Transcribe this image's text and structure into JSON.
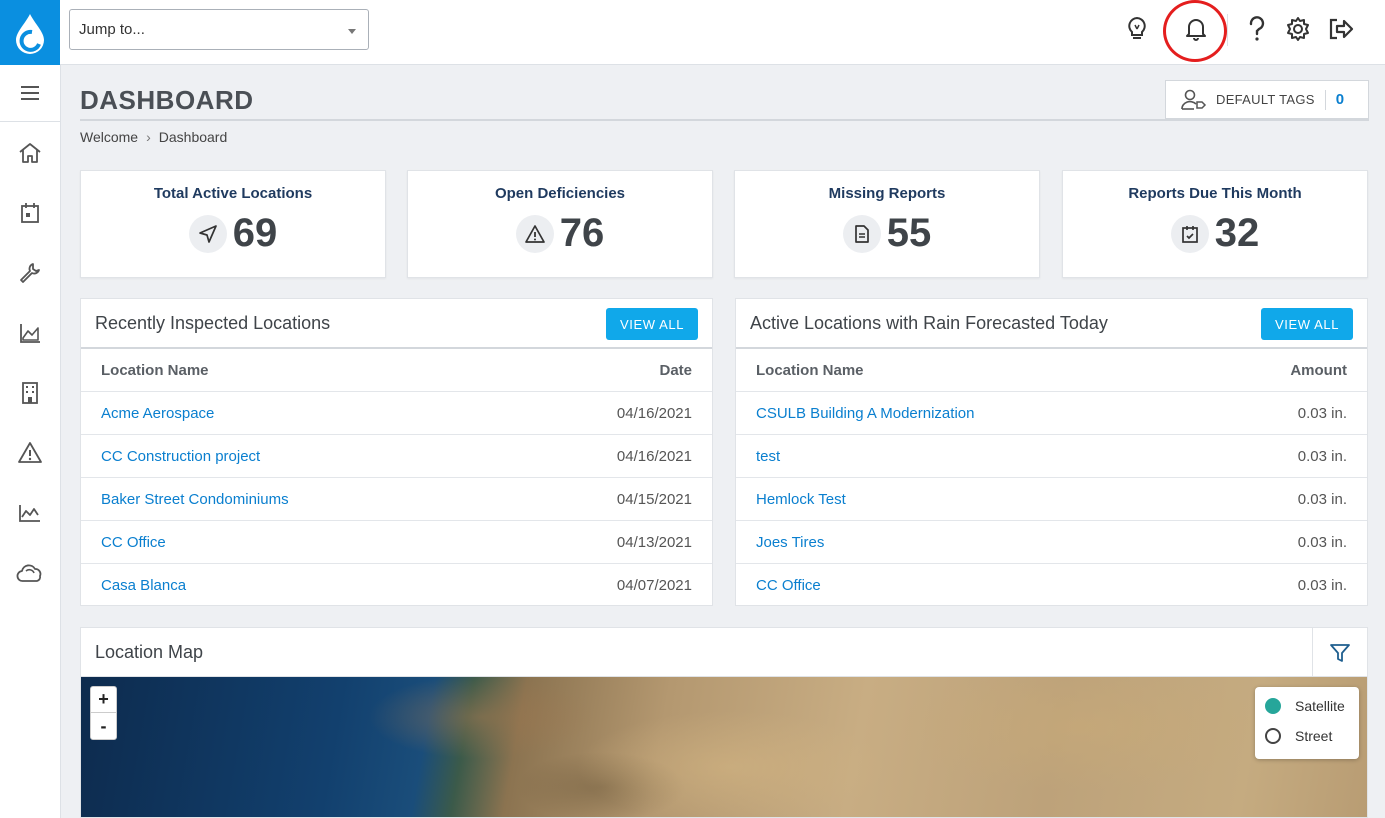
{
  "header": {
    "jump_placeholder": "Jump to...",
    "page_title": "DASHBOARD",
    "breadcrumb": [
      "Welcome",
      "Dashboard"
    ],
    "default_tags_label": "DEFAULT TAGS",
    "default_tags_count": "0"
  },
  "topbar_icons": [
    "lightbulb-icon",
    "bell-icon",
    "help-icon",
    "gear-icon",
    "logout-icon"
  ],
  "sidebar_icons": [
    "menu-icon",
    "home-icon",
    "calendar-icon",
    "wrench-icon",
    "chart-icon",
    "building-icon",
    "warning-icon",
    "area-chart-icon",
    "cloud-icon"
  ],
  "stats": [
    {
      "label": "Total Active Locations",
      "value": "69",
      "icon": "navigation-icon"
    },
    {
      "label": "Open Deficiencies",
      "value": "76",
      "icon": "warning-icon"
    },
    {
      "label": "Missing Reports",
      "value": "55",
      "icon": "document-icon"
    },
    {
      "label": "Reports Due This Month",
      "value": "32",
      "icon": "calendar-check-icon"
    }
  ],
  "recent": {
    "title": "Recently Inspected Locations",
    "view_all": "VIEW ALL",
    "col_name": "Location Name",
    "col_value": "Date",
    "rows": [
      {
        "name": "Acme Aerospace",
        "value": "04/16/2021"
      },
      {
        "name": "CC Construction project",
        "value": "04/16/2021"
      },
      {
        "name": "Baker Street Condominiums",
        "value": "04/15/2021"
      },
      {
        "name": "CC Office",
        "value": "04/13/2021"
      },
      {
        "name": "Casa Blanca",
        "value": "04/07/2021"
      }
    ]
  },
  "rain": {
    "title": "Active Locations with Rain Forecasted Today",
    "view_all": "VIEW ALL",
    "col_name": "Location Name",
    "col_value": "Amount",
    "rows": [
      {
        "name": "CSULB Building A Modernization",
        "value": "0.03 in."
      },
      {
        "name": "test",
        "value": "0.03 in."
      },
      {
        "name": "Hemlock Test",
        "value": "0.03 in."
      },
      {
        "name": "Joes Tires",
        "value": "0.03 in."
      },
      {
        "name": "CC Office",
        "value": "0.03 in."
      }
    ]
  },
  "map": {
    "title": "Location Map",
    "zoom_in": "+",
    "zoom_out": "-",
    "layers": [
      {
        "label": "Satellite",
        "selected": true
      },
      {
        "label": "Street",
        "selected": false
      }
    ]
  },
  "colors": {
    "brand": "#0a8fe0",
    "button": "#10a8ea",
    "link": "#0a7fcf",
    "highlight_ring": "#e41e1e",
    "satellite_radio": "#26a69a"
  }
}
